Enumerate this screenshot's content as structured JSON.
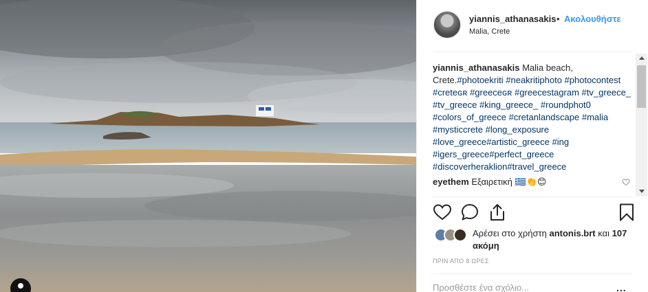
{
  "post": {
    "username": "yiannis_athanasakis",
    "separator": "•",
    "follow_label": "Ακολουθήστε",
    "location": "Malia, Crete"
  },
  "caption": {
    "username": "yiannis_athanasakis",
    "text": "Malia beach, Crete.",
    "tags": [
      "#photoekriti",
      "#neakritiphoto",
      "#photocontest",
      "#creteɢʀ",
      "#greeceɢʀ",
      "#greecestagram",
      "#tv_greece_",
      "#tv_greece",
      "#king_greece_",
      "#roundphot0",
      "#colors_of_greece",
      "#cretanlandscape",
      "#malia",
      "#mysticcrete",
      "#long_exposure",
      "#love_greece",
      "#artistic_greece",
      "#ing",
      "#igers_greece",
      "#perfect_greece",
      "#discoverheraklion",
      "#travel_greece"
    ]
  },
  "comment2": {
    "username": "eyethem",
    "text": "Εξαιρετική 🇬🇷👏😊"
  },
  "likes": {
    "prefix": "Αρέσει στο χρήστη",
    "user": "antonis.brt",
    "suffix": "και",
    "others": "107 ακόμη"
  },
  "timestamp": "ΠΡΙΝ ΑΠΟ 8 ΩΡΕΣ",
  "comment_box": {
    "placeholder": "Προσθέστε ένα σχόλιο...",
    "more_label": "..."
  },
  "icons": {
    "like": "heart-icon",
    "comment": "comment-icon",
    "share": "share-icon",
    "save": "bookmark-icon",
    "comment_like": "heart-icon-small",
    "user_tag": "person-tag-icon"
  },
  "colors": {
    "link": "#3897f0",
    "hashtag": "#003569",
    "muted": "#999999",
    "text": "#262626"
  }
}
